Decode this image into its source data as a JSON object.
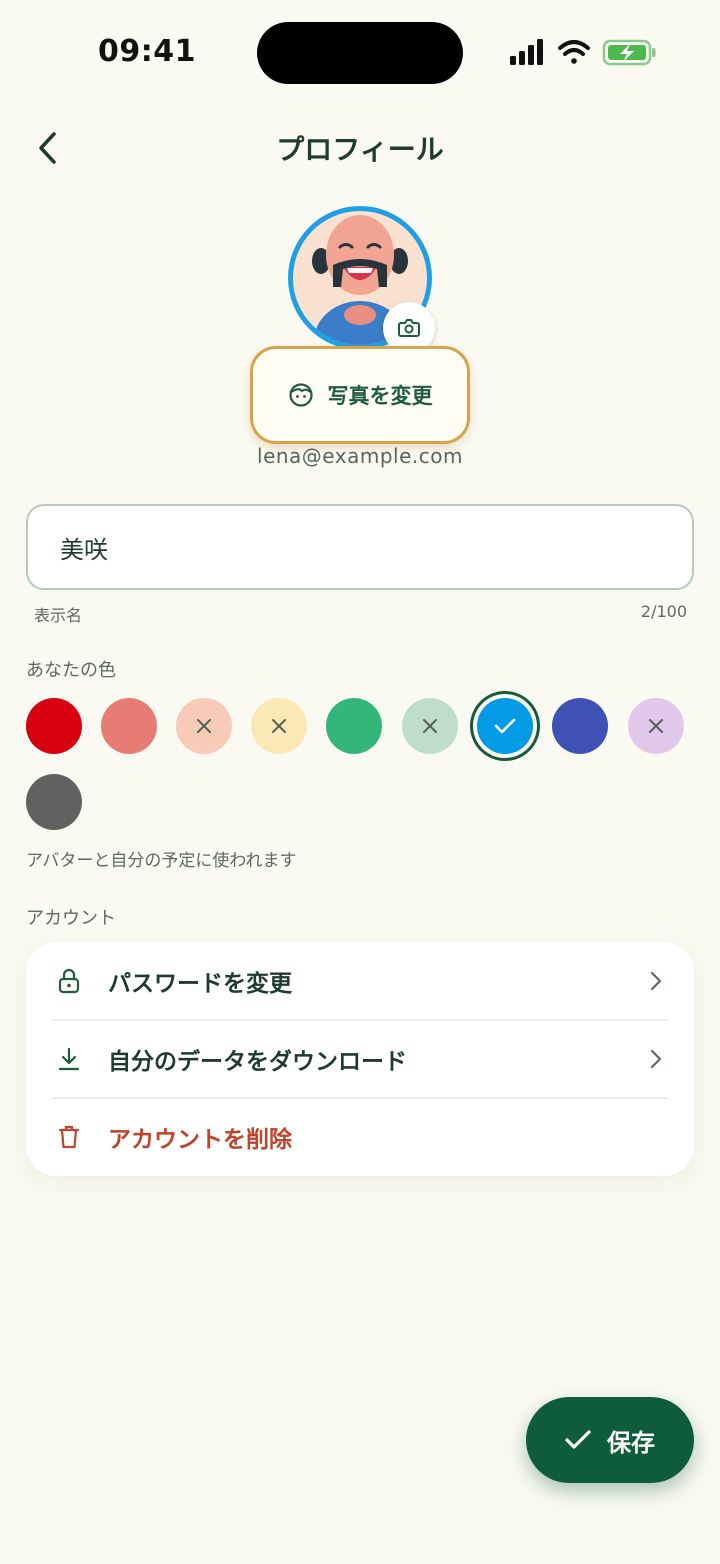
{
  "status_bar": {
    "time": "09:41"
  },
  "header": {
    "title": "プロフィール",
    "back_icon": "chevron-left-icon"
  },
  "profile": {
    "change_photo_label": "写真を変更",
    "email": "lena@example.com"
  },
  "name_field": {
    "value": "美咲",
    "label": "表示名",
    "counter": "2/100"
  },
  "colors": {
    "section_label": "あなたの色",
    "hint": "アバターと自分の予定に使われます",
    "swatches": [
      {
        "hex": "#d80010",
        "state": "available"
      },
      {
        "hex": "#e67c73",
        "state": "available"
      },
      {
        "hex": "#f8cbb9",
        "state": "disabled"
      },
      {
        "hex": "#fbe8b6",
        "state": "disabled"
      },
      {
        "hex": "#33b679",
        "state": "available"
      },
      {
        "hex": "#bfdec9",
        "state": "disabled"
      },
      {
        "hex": "#039be5",
        "state": "selected"
      },
      {
        "hex": "#3f51b5",
        "state": "available"
      },
      {
        "hex": "#e1c7e9",
        "state": "disabled"
      },
      {
        "hex": "#616161",
        "state": "available"
      }
    ]
  },
  "account": {
    "section_label": "アカウント",
    "items": [
      {
        "label": "パスワードを変更",
        "icon": "lock-icon",
        "color": "#1f3a2e"
      },
      {
        "label": "自分のデータをダウンロード",
        "icon": "download-icon",
        "color": "#1f3a2e"
      },
      {
        "label": "アカウントを削除",
        "icon": "trash-icon",
        "color": "#c0432b"
      }
    ]
  },
  "fab": {
    "label": "保存",
    "icon": "check-icon"
  },
  "theme": {
    "accent": "#0f5c3d",
    "background": "#fbfaf2",
    "danger": "#c0432b",
    "highlight": "#d7a34d"
  }
}
